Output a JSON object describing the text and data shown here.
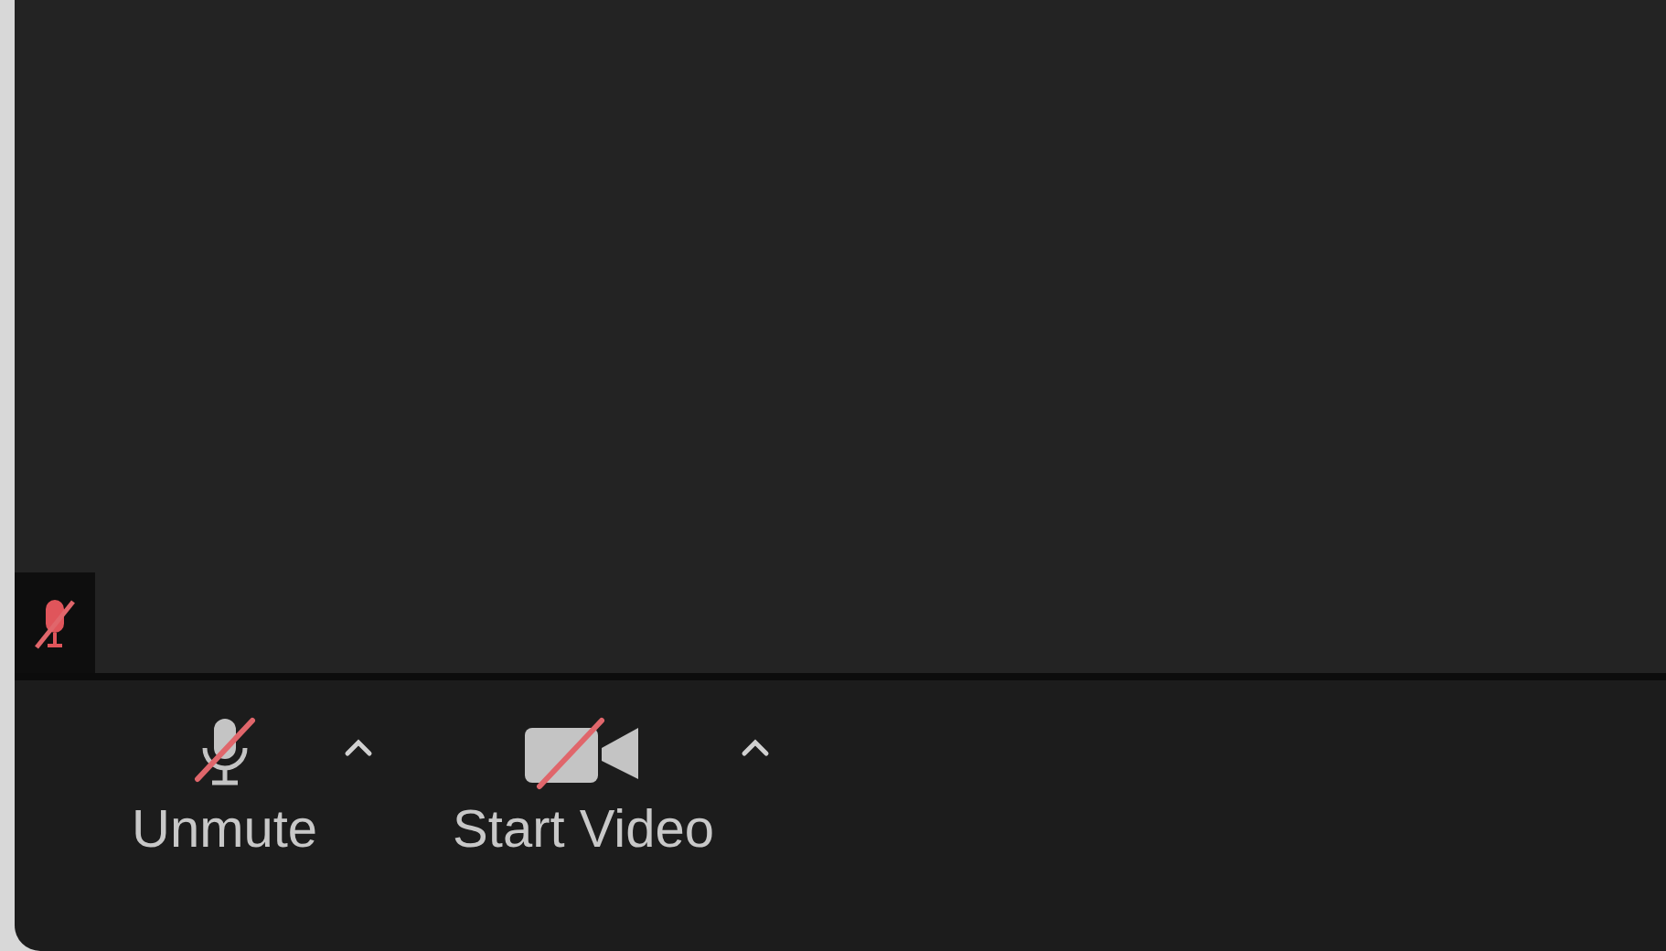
{
  "video_tile": {
    "muted": true
  },
  "toolbar": [
    {
      "kind": "audio",
      "label": "Unmute",
      "muted": true
    },
    {
      "kind": "video",
      "label": "Start Video",
      "muted": true
    }
  ]
}
